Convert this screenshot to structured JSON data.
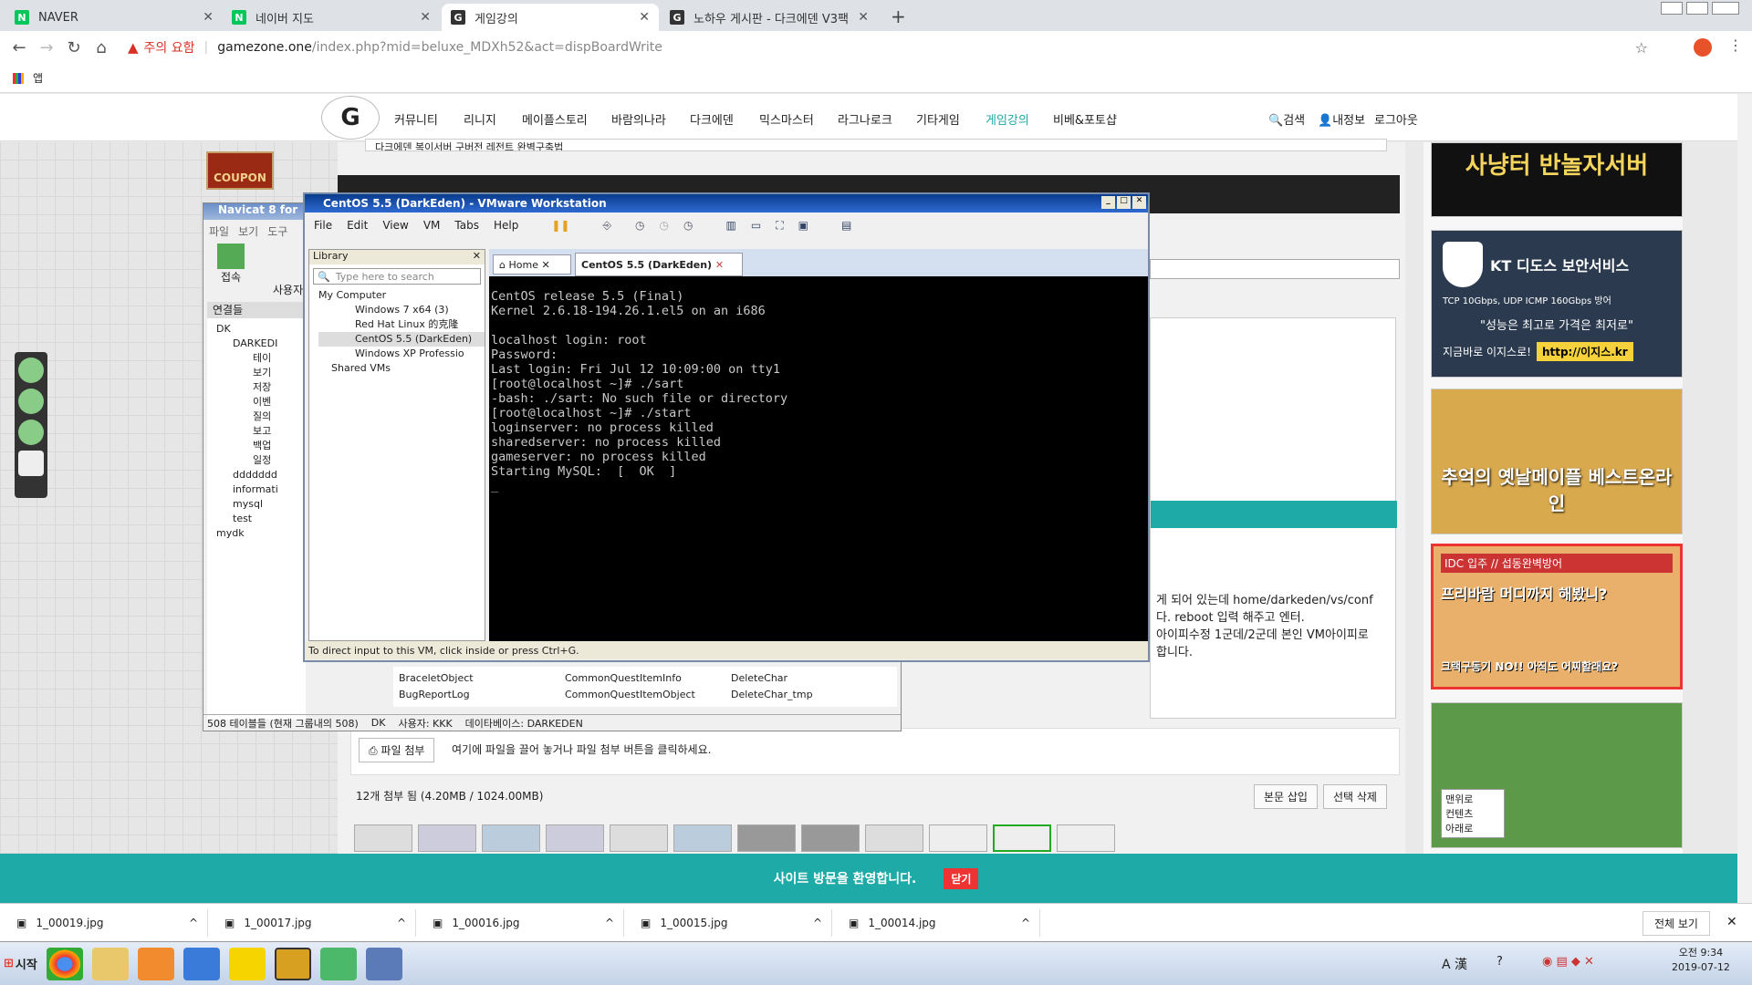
{
  "browser": {
    "tabs": [
      {
        "label": "NAVER",
        "fav": "N",
        "color": "#03c75a"
      },
      {
        "label": "네이버 지도",
        "fav": "N",
        "color": "#03c75a"
      },
      {
        "label": "게임강의",
        "fav": "G",
        "color": "#333"
      },
      {
        "label": "노하우 게시판 - 다크에덴 V3팩",
        "fav": "G",
        "color": "#333"
      }
    ],
    "new_tab": "+",
    "security_warning": "주의 요함",
    "url_domain": "gamezone.one",
    "url_path": "/index.php?mid=beluxe_MDXh52&act=dispBoardWrite",
    "bookmark_apps": "앱"
  },
  "site": {
    "menu": [
      "커뮤니티",
      "리니지",
      "메이플스토리",
      "바람의나라",
      "다크에덴",
      "믹스마스터",
      "라그나로크",
      "기타게임",
      "게임강의",
      "비베&포토샵"
    ],
    "active_menu": "게임강의",
    "search": "검색",
    "myinfo": "내정보",
    "logout": "로그아웃",
    "partial_line": "다크에덴 복이서버 구버전 레전트 완벽구축법",
    "body_text": [
      "게 되어 있는데 home/darkeden/vs/conf",
      "다. reboot 입력 해주고 엔터.",
      "아이피수정 1군데/2군데 본인 VM아이피로",
      "합니다."
    ],
    "attach_button": "파일 첨부",
    "attach_hint": "여기에 파일을 끌어 놓거나 파일 첨부 버튼을 클릭하세요.",
    "attach_count": "12개 첨부 됨 (4.20MB / 1024.00MB)",
    "insert_button": "본문 삽입",
    "delete_button": "선택 삭제",
    "welcome": "사이트 방문을 환영합니다.",
    "close": "닫기",
    "coupon": "COUPON"
  },
  "ads": {
    "ad1": "사냥터 반놀자서버",
    "ad2_title": "KT 디도스 보안서비스",
    "ad2_sub": "TCP 10Gbps, UDP ICMP 160Gbps 방어",
    "ad2_quote": "\"성능은 최고로 가격은 최저로\"",
    "ad2_cta": "지금바로 이지스로!",
    "ad2_url": "http://이지스.kr",
    "ad3": "추억의 옛날메이플 베스트온라인",
    "ad4_title": "IDC 입주 // 섭동완벽방어",
    "ad4_body": "프리바람 머디까지 해봤니?",
    "ad4_foot": "크랙구동기 NO!! 아직도 어찌할래요?",
    "float_menu": [
      "맨위로",
      "컨텐츠",
      "아래로"
    ]
  },
  "navicat": {
    "title": "Navicat 8 for",
    "menu": [
      "파일",
      "보기",
      "도구"
    ],
    "connect": "접속",
    "user": "사용자",
    "conn_header": "연결들",
    "tree": [
      "DK",
      "DARKEDI",
      "테이",
      "보기",
      "저장",
      "이벤",
      "질의",
      "보고",
      "백업",
      "일정",
      "ddddddd",
      "informati",
      "mysql",
      "test",
      "mydk"
    ],
    "tables": [
      "BraceletObject",
      "CommonQuestItemInfo",
      "DeleteChar",
      "BugReportLog",
      "CommonQuestItemObject",
      "DeleteChar_tmp"
    ],
    "status_count": "508 테이블들 (현재 그룹내의 508)",
    "status_conn": "DK",
    "status_user": "사용자: KKK",
    "status_db": "데이타베이스: DARKEDEN"
  },
  "vmware": {
    "title": "CentOS 5.5 (DarkEden) - VMware Workstation",
    "menu": [
      "File",
      "Edit",
      "View",
      "VM",
      "Tabs",
      "Help"
    ],
    "library_title": "Library",
    "search_placeholder": "Type here to search",
    "tree": [
      "My Computer",
      "Windows 7 x64 (3)",
      "Red Hat Linux 的克隆",
      "CentOS 5.5 (DarkEden)",
      "Windows XP Professio",
      "Shared VMs"
    ],
    "tab_home": "Home",
    "tab_vm": "CentOS 5.5 (DarkEden)",
    "console": "CentOS release 5.5 (Final)\nKernel 2.6.18-194.26.1.el5 on an i686\n\nlocalhost login: root\nPassword:\nLast login: Fri Jul 12 10:09:00 on tty1\n[root@localhost ~]# ./sart\n-bash: ./sart: No such file or directory\n[root@localhost ~]# ./start\nloginserver: no process killed\nsharedserver: no process killed\ngameserver: no process killed\nStarting MySQL:  [  OK  ]\n_",
    "status": "To direct input to this VM, click inside or press Ctrl+G."
  },
  "downloads": [
    "1_00019.jpg",
    "1_00017.jpg",
    "1_00016.jpg",
    "1_00015.jpg",
    "1_00014.jpg"
  ],
  "downloads_all": "전체 보기",
  "taskbar": {
    "start": "시작",
    "time": "오전 9:34",
    "date": "2019-07-12",
    "ime": "A 漢"
  }
}
